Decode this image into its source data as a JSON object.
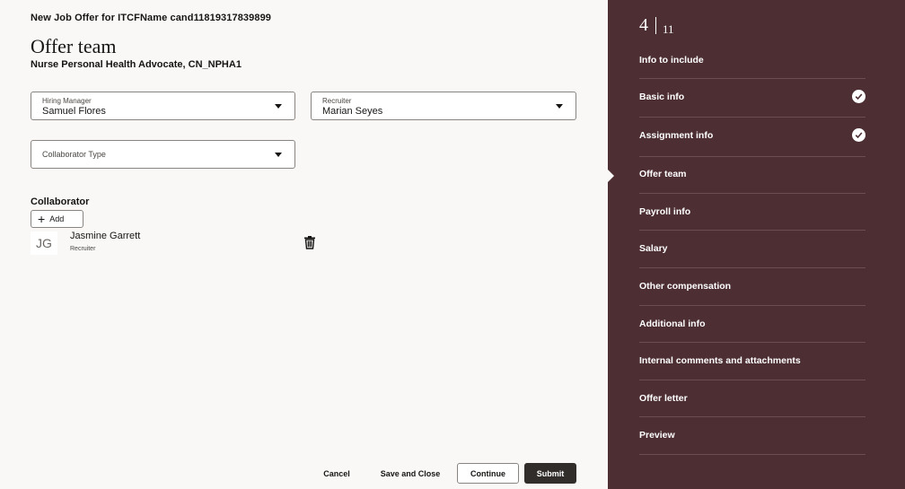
{
  "header": {
    "page_title": "New Job Offer for ITCFName cand11819317839899",
    "section_title": "Offer team",
    "job_subtitle": "Nurse Personal Health Advocate, CN_NPHA1"
  },
  "fields": {
    "hiring_manager": {
      "label": "Hiring Manager",
      "value": "Samuel Flores"
    },
    "recruiter": {
      "label": "Recruiter",
      "value": "Marian Seyes"
    },
    "collaborator_type": {
      "placeholder": "Collaborator Type"
    }
  },
  "collaborators": {
    "title": "Collaborator",
    "add_label": "Add",
    "add_icon": "plus-icon",
    "items": [
      {
        "initials": "JG",
        "name": "Jasmine Garrett",
        "role": "Recruiter",
        "delete_icon": "trash-icon"
      }
    ]
  },
  "footer": {
    "cancel": "Cancel",
    "save_close": "Save and Close",
    "continue": "Continue",
    "submit": "Submit"
  },
  "progress": {
    "current": "4",
    "total": "11",
    "steps": [
      {
        "label": "Info to include",
        "completed": false,
        "current": false
      },
      {
        "label": "Basic info",
        "completed": true,
        "current": false
      },
      {
        "label": "Assignment info",
        "completed": true,
        "current": false
      },
      {
        "label": "Offer team",
        "completed": false,
        "current": true
      },
      {
        "label": "Payroll info",
        "completed": false,
        "current": false
      },
      {
        "label": "Salary",
        "completed": false,
        "current": false
      },
      {
        "label": "Other compensation",
        "completed": false,
        "current": false
      },
      {
        "label": "Additional info",
        "completed": false,
        "current": false
      },
      {
        "label": "Internal comments and attachments",
        "completed": false,
        "current": false
      },
      {
        "label": "Offer letter",
        "completed": false,
        "current": false
      },
      {
        "label": "Preview",
        "completed": false,
        "current": false
      }
    ]
  },
  "colors": {
    "sidebar_bg": "#4c2e33",
    "primary_button": "#312d2a",
    "page_bg": "#faf8f7"
  }
}
